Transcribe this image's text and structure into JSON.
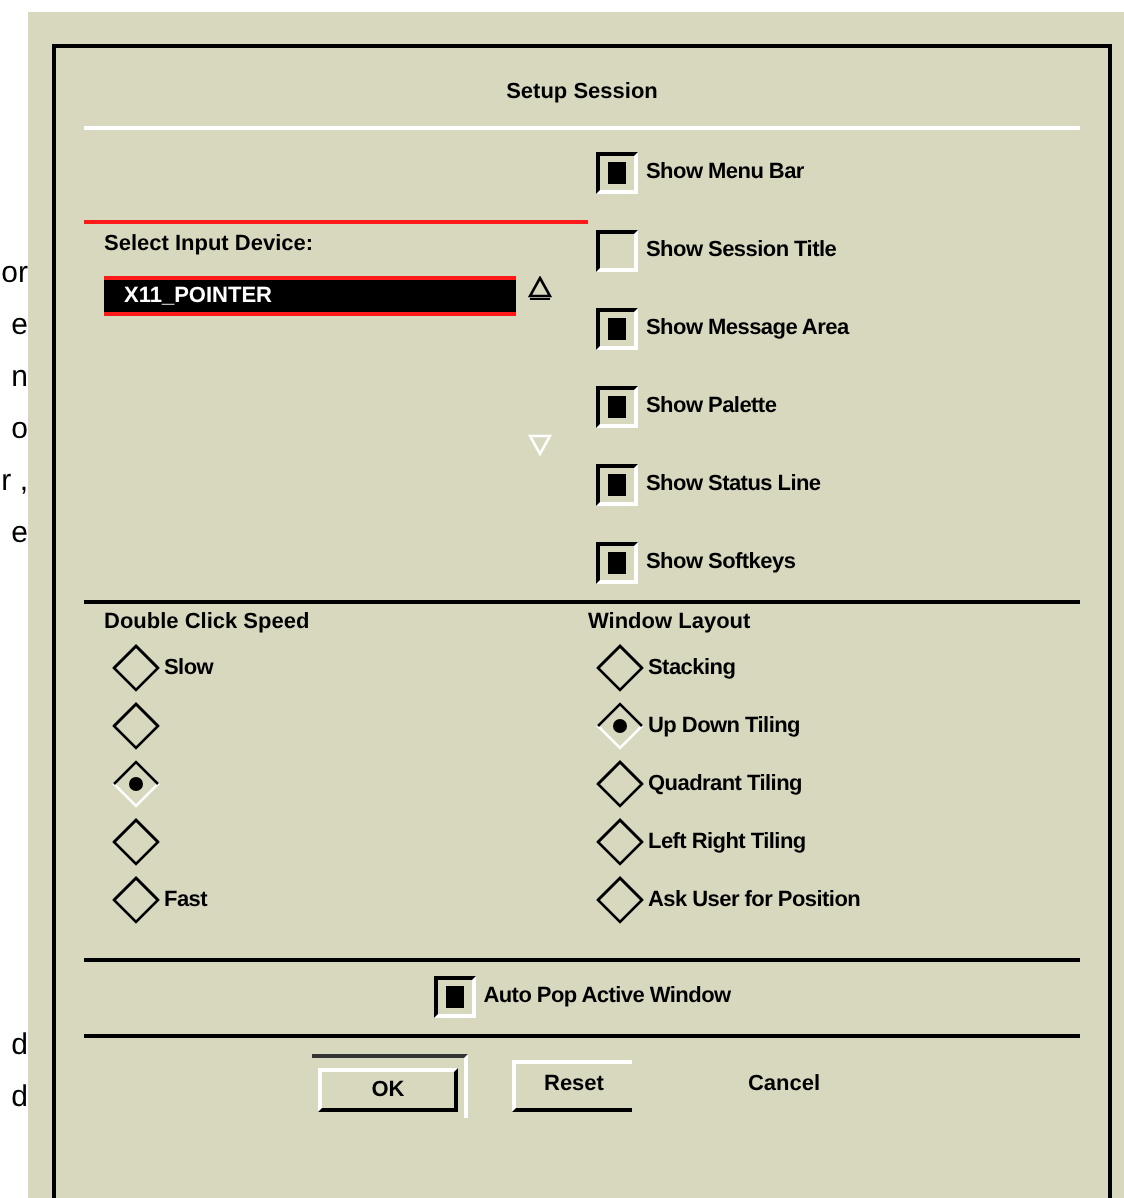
{
  "background_text": [
    "or",
    "e",
    "n",
    "o",
    "r ,",
    "e",
    "d",
    "d"
  ],
  "dialog": {
    "title": "Setup Session",
    "device_list": {
      "label": "Select Input Device:",
      "items": [
        {
          "label": "X11_POINTER",
          "selected": true
        }
      ]
    },
    "display_options": [
      {
        "label": "Show Menu Bar",
        "checked": true
      },
      {
        "label": "Show Session Title",
        "checked": false
      },
      {
        "label": "Show Message Area",
        "checked": true
      },
      {
        "label": "Show Palette",
        "checked": true
      },
      {
        "label": "Show Status Line",
        "checked": true
      },
      {
        "label": "Show Softkeys",
        "checked": true
      }
    ],
    "double_click_speed": {
      "title": "Double Click Speed",
      "options": [
        {
          "label": "Slow",
          "selected": false
        },
        {
          "selected": false
        },
        {
          "selected": true
        },
        {
          "selected": false
        },
        {
          "label": "Fast",
          "selected": false
        }
      ]
    },
    "window_layout": {
      "title": "Window Layout",
      "options": [
        {
          "label": "Stacking",
          "selected": false
        },
        {
          "label": "Up Down Tiling",
          "selected": true
        },
        {
          "label": "Quadrant Tiling",
          "selected": false
        },
        {
          "label": "Left Right Tiling",
          "selected": false
        },
        {
          "label": "Ask User for Position",
          "selected": false
        }
      ]
    },
    "auto_pop": {
      "label": "Auto Pop Active Window",
      "checked": true
    },
    "buttons": [
      {
        "label": "OK",
        "kind": "default"
      },
      {
        "label": "Reset",
        "kind": "shadowed"
      },
      {
        "label": "Cancel",
        "kind": "flat"
      }
    ]
  }
}
